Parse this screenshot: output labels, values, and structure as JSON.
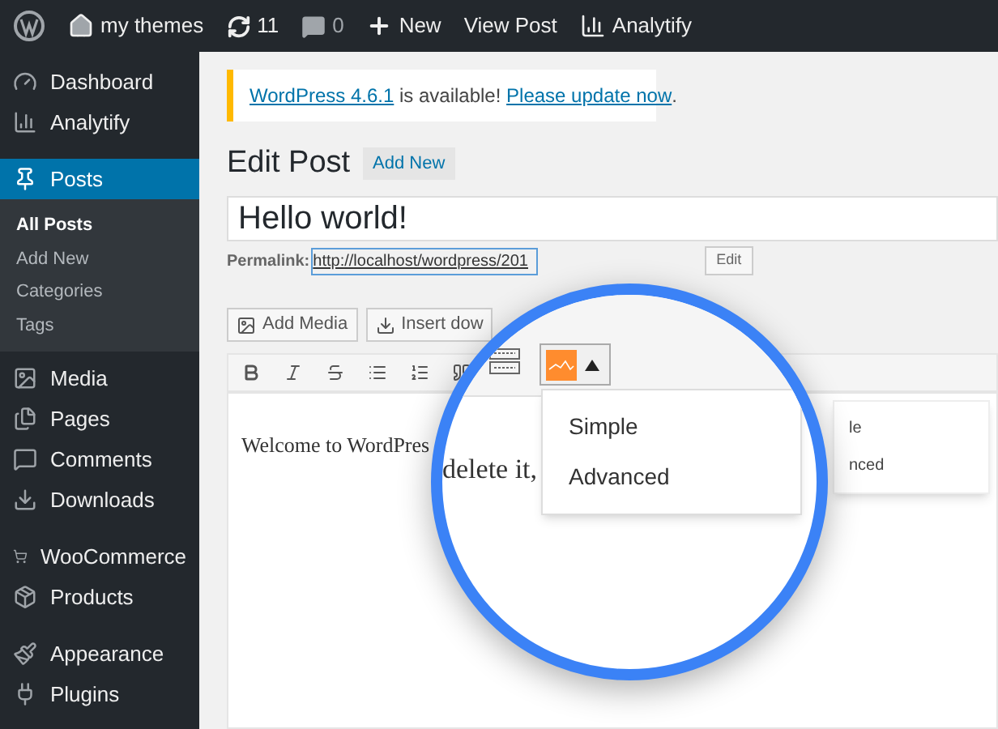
{
  "admin_bar": {
    "items": [
      {
        "kind": "logo"
      },
      {
        "kind": "home",
        "label": "my themes"
      },
      {
        "kind": "updates",
        "label": "11"
      },
      {
        "kind": "comments",
        "label": "0"
      },
      {
        "kind": "new",
        "label": "New"
      },
      {
        "kind": "text",
        "label": "View Post"
      },
      {
        "kind": "analytics",
        "label": "Analytify"
      }
    ]
  },
  "sidebar": {
    "groups": [
      [
        {
          "label": "Dashboard",
          "selected": false
        },
        {
          "label": "Analytify",
          "selected": false
        }
      ],
      [
        {
          "label": "Posts",
          "selected": true,
          "children": [
            {
              "label": "All Posts",
              "selected": true
            },
            {
              "label": "Add New",
              "selected": false
            },
            {
              "label": "Categories",
              "selected": false
            },
            {
              "label": "Tags",
              "selected": false
            }
          ]
        },
        {
          "label": "Media",
          "selected": false
        },
        {
          "label": "Pages",
          "selected": false
        },
        {
          "label": "Comments",
          "selected": false
        },
        {
          "label": "Downloads",
          "selected": false
        }
      ],
      [
        {
          "label": "WooCommerce",
          "selected": false
        },
        {
          "label": "Products",
          "selected": false
        }
      ],
      [
        {
          "label": "Appearance",
          "selected": false
        },
        {
          "label": "Plugins",
          "selected": false
        }
      ]
    ]
  },
  "notice": {
    "link": "WordPress 4.6.1",
    "text": " is available! ",
    "action": "Please update now",
    "end": "."
  },
  "heading": {
    "title": "Edit Post",
    "button": "Add New"
  },
  "title_field": {
    "value": "Hello world!"
  },
  "permalink": {
    "label": "Permalink:",
    "url": "http://localhost/wordpress/201",
    "button": "Edit"
  },
  "media_buttons": [
    {
      "label": "Add Media"
    },
    {
      "label": "Insert dow"
    }
  ],
  "toolbar": [
    {
      "kind": "bold"
    },
    {
      "kind": "italic"
    },
    {
      "kind": "strike"
    },
    {
      "kind": "ul"
    },
    {
      "kind": "ol"
    },
    {
      "kind": "quote"
    }
  ],
  "editor": {
    "text": "Welcome to WordPres"
  },
  "back_menu": {
    "items": [
      "le",
      "nced"
    ]
  },
  "magnifier": {
    "text": "delete it,",
    "menu": [
      {
        "label": "Simple",
        "selected": false
      },
      {
        "label": "Advanced",
        "selected": false
      }
    ]
  }
}
